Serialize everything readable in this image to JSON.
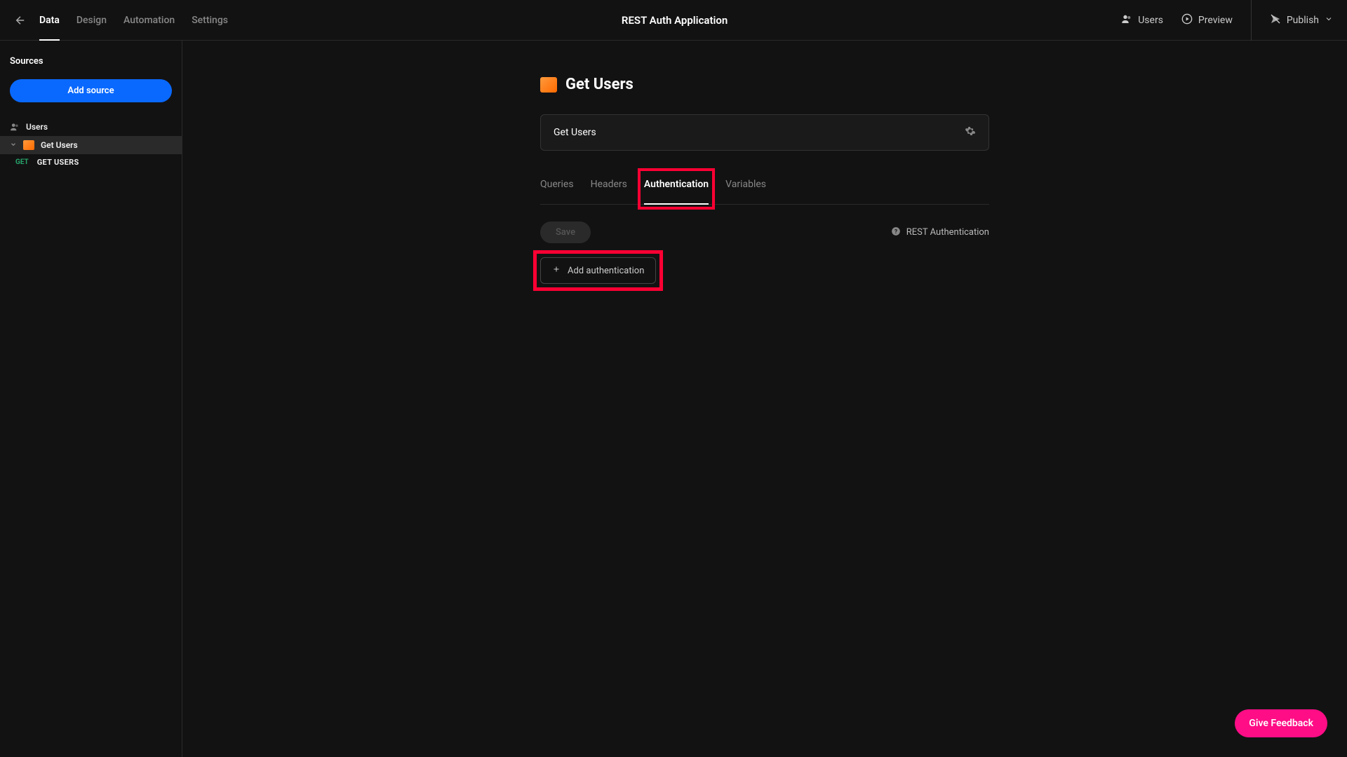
{
  "app_title": "REST Auth Application",
  "nav_tabs": {
    "data": "Data",
    "design": "Design",
    "automation": "Automation",
    "settings": "Settings"
  },
  "header_actions": {
    "users": "Users",
    "preview": "Preview",
    "publish": "Publish"
  },
  "sidebar": {
    "title": "Sources",
    "add_source": "Add source",
    "items": {
      "users": "Users",
      "get_users": "Get Users"
    },
    "endpoint": {
      "method": "GET",
      "name": "GET USERS"
    }
  },
  "page": {
    "title": "Get Users",
    "name_value": "Get Users"
  },
  "cfg_tabs": {
    "queries": "Queries",
    "headers": "Headers",
    "authentication": "Authentication",
    "variables": "Variables"
  },
  "actions": {
    "save": "Save",
    "help_link": "REST Authentication",
    "add_auth": "Add authentication"
  },
  "feedback_label": "Give Feedback"
}
